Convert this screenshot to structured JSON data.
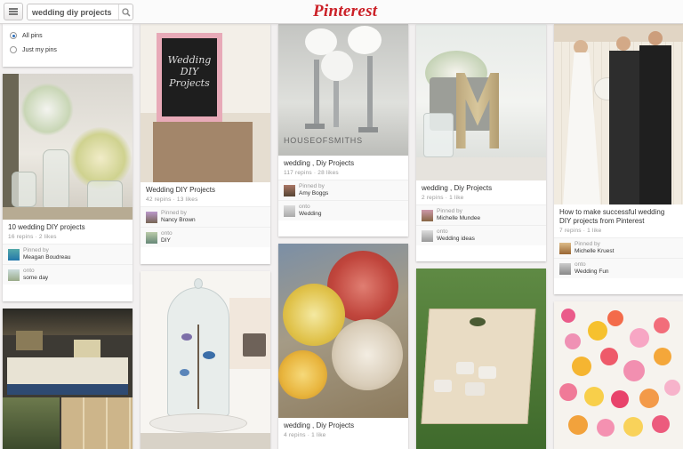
{
  "header": {
    "logo": "Pinterest",
    "search_value": "wedding diy projects"
  },
  "filter": {
    "options": [
      {
        "label": "All pins",
        "selected": true
      },
      {
        "label": "Just my pins",
        "selected": false
      }
    ]
  },
  "pins": [
    {
      "caption": "10 wedding DIY projects",
      "stats": "16 repins · 2 likes",
      "pinned_by_label": "Pinned by",
      "pinned_by": "Meagan Boudreau",
      "onto_label": "onto",
      "onto": "some day"
    },
    {
      "board_text": "Wedding DIY Projects",
      "caption": "Wedding DIY Projects",
      "stats": "42 repins · 13 likes",
      "pinned_by_label": "Pinned by",
      "pinned_by": "Nancy Brown",
      "onto_label": "onto",
      "onto": "DIY"
    },
    {
      "image_text": "HOUSEOFSMITHS",
      "caption": "wedding , Diy Projects",
      "stats": "117 repins · 28 likes",
      "pinned_by_label": "Pinned by",
      "pinned_by": "Amy Boggs",
      "onto_label": "onto",
      "onto": "Wedding"
    },
    {
      "caption": "wedding , Diy Projects",
      "stats": "2 repins · 1 like",
      "pinned_by_label": "Pinned by",
      "pinned_by": "Michelle Mundee",
      "onto_label": "onto",
      "onto": "Wedding ideas"
    },
    {
      "caption": "How to make successful wedding DIY projects from Pinterest",
      "stats": "7 repins · 1 like",
      "pinned_by_label": "Pinned by",
      "pinned_by": "Michelle Kruest",
      "onto_label": "onto",
      "onto": "Wedding Fun"
    },
    {
      "caption": "wedding , Diy Projects",
      "stats": "4 repins · 1 like"
    }
  ]
}
